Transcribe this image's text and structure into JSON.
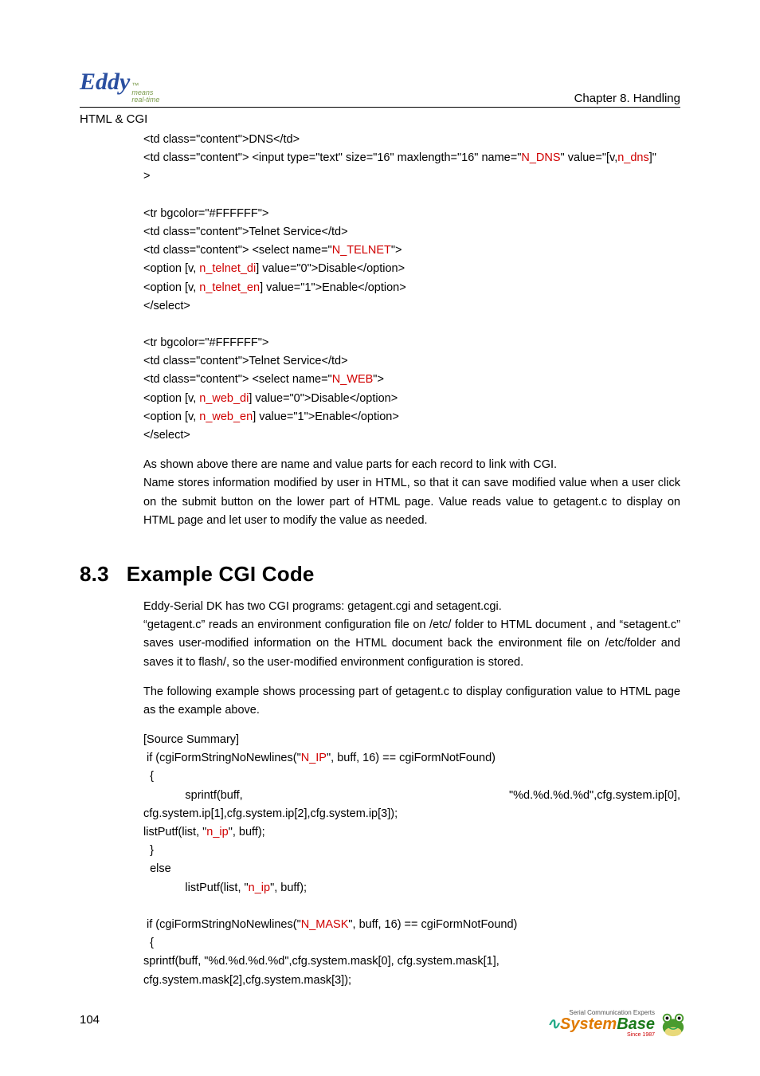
{
  "header": {
    "logo_main": "Eddy",
    "logo_tm": "™",
    "logo_sub1": "means",
    "logo_sub2": "real-time",
    "chapter": "Chapter 8. Handling",
    "section_label": "HTML & CGI"
  },
  "code1": {
    "l1": {
      "pre": "<td class=\"content\">DNS</td>"
    },
    "l2": {
      "a": "<td class=\"content\"> <input type=\"text\" size=\"16\" maxlength=\"16\" name=\"",
      "b": "N_DNS",
      "c": "\" value=\"[v,",
      "d": "n_dns",
      "e": "]\""
    },
    "l3": {
      "a": ">"
    },
    "blank1": " ",
    "l4": {
      "a": "<tr bgcolor=\"#FFFFFF\">"
    },
    "l5": {
      "a": "<td class=\"content\">Telnet Service</td>"
    },
    "l6": {
      "a": "<td class=\"content\"> <select name=\"",
      "b": "N_TELNET",
      "c": "\">"
    },
    "l7": {
      "a": "<option [v, ",
      "b": "n_telnet_di",
      "c": "] value=\"0\">Disable</option>"
    },
    "l8": {
      "a": "<option [v, ",
      "b": "n_telnet_en",
      "c": "] value=\"1\">Enable</option>"
    },
    "l9": {
      "a": "</select>"
    },
    "blank2": " ",
    "l10": {
      "a": "<tr bgcolor=\"#FFFFFF\">"
    },
    "l11": {
      "a": "<td class=\"content\">Telnet Service</td>"
    },
    "l12": {
      "a": "<td class=\"content\"> <select name=\"",
      "b": "N_WEB",
      "c": "\">"
    },
    "l13": {
      "a": "<option [v, ",
      "b": "n_web_di",
      "c": "] value=\"0\">Disable</option>"
    },
    "l14": {
      "a": "<option [v, ",
      "b": "n_web_en",
      "c": "] value=\"1\">Enable</option>"
    },
    "l15": {
      "a": "</select>"
    }
  },
  "para1": "As shown above there are name and value parts for each record to link with CGI.",
  "para2": "Name stores information modified by user in HTML, so that it can save modified value when a user click on the submit button on the lower part of HTML page.  Value reads value to getagent.c to display on HTML page and let user to modify the value as needed.",
  "h2": {
    "num": "8.3",
    "title": "Example CGI Code"
  },
  "para3": "Eddy-Serial DK has two CGI programs: getagent.cgi and setagent.cgi.",
  "para4": "“getagent.c”  reads an environment configuration file on /etc/ folder to HTML document , and “setagent.c”  saves user-modified information on the HTML document back the environment file on /etc/folder and saves it to flash/, so the user-modified environment configuration is stored.",
  "para5": "The following example shows processing part of getagent.c to display configuration value to HTML page as the example above.",
  "code2": {
    "l1": "[Source Summary]",
    "l2": {
      "a": " if (cgiFormStringNoNewlines(\"",
      "b": "N_IP",
      "c": "\", buff, 16) == cgiFormNotFound)"
    },
    "l3": "  {",
    "l4a": "             sprintf(buff,",
    "l4b": "\"%d.%d.%d.%d\",cfg.system.ip[0],",
    "l5": "cfg.system.ip[1],cfg.system.ip[2],cfg.system.ip[3]);",
    "l6": {
      "a": "listPutf(list, \"",
      "b": "n_ip",
      "c": "\", buff);"
    },
    "l7": "  }",
    "l8": "  else",
    "l9": {
      "a": "             listPutf(list, \"",
      "b": "n_ip",
      "c": "\", buff);"
    },
    "blank": " ",
    "l10": {
      "a": " if (cgiFormStringNoNewlines(\"",
      "b": "N_MASK",
      "c": "\", buff, 16) == cgiFormNotFound)"
    },
    "l11": "  {",
    "l12": "sprintf(buff, \"%d.%d.%d.%d\",cfg.system.mask[0], cfg.system.mask[1],",
    "l13": "cfg.system.mask[2],cfg.system.mask[3]);"
  },
  "footer": {
    "page_number": "104",
    "sb_tag": "Serial Communication Experts",
    "sb_name1": "System",
    "sb_name2": "Base",
    "sb_since": "Since 1987"
  }
}
